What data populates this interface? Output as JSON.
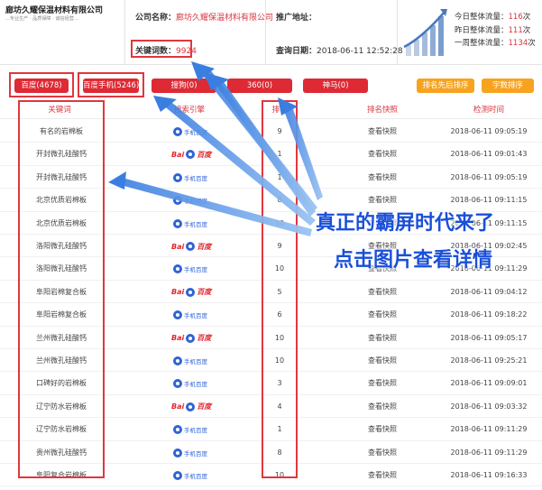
{
  "company": {
    "logo_name": "廊坊久耀保温材料有限公司",
    "logo_tagline": "...专业生产 · 品质保障 · 诚信经营...",
    "name_label": "公司名称：",
    "name_value": "廊坊久耀保温材料有限公司",
    "keywords_label": "关键词数：",
    "keywords_value": "9924",
    "site_label": "推广地址：",
    "site_value": "",
    "query_label": "查询日期：",
    "query_value": "2018-06-11 12:52:28"
  },
  "stats": {
    "today_label": "今日整体流量：",
    "today_value": "116",
    "yesterday_label": "昨日整体流量：",
    "yesterday_value": "111",
    "week_label": "一周整体流量：",
    "week_value": "1134",
    "unit": "次"
  },
  "tabs": [
    {
      "label": "百度(4678)"
    },
    {
      "label": "百度手机(5246)"
    },
    {
      "label": "搜狗(0)"
    },
    {
      "label": "360(0)"
    },
    {
      "label": "神马(0)"
    }
  ],
  "buttons": {
    "sort_rank": "排名先后排序",
    "sort_char": "字数排序"
  },
  "table": {
    "headers": [
      "关键词",
      "搜索引擎",
      "排名",
      "排名快照",
      "检测时间"
    ],
    "rows": [
      {
        "keyword": "有名的岩棉板",
        "engine": "mobile",
        "rank": "9",
        "snapshot": "查看快照",
        "time": "2018-06-11 09:05:19"
      },
      {
        "keyword": "开封微孔硅酸钙",
        "engine": "baidu",
        "rank": "1",
        "snapshot": "查看快照",
        "time": "2018-06-11 09:01:43"
      },
      {
        "keyword": "开封微孔硅酸钙",
        "engine": "mobile",
        "rank": "1",
        "snapshot": "查看快照",
        "time": "2018-06-11 09:05:19"
      },
      {
        "keyword": "北京优质岩棉板",
        "engine": "mobile",
        "rank": "8",
        "snapshot": "查看快照",
        "time": "2018-06-11 09:11:15"
      },
      {
        "keyword": "北京优质岩棉板",
        "engine": "mobile",
        "rank": "10",
        "snapshot": "查看快照",
        "time": "2018-06-11 09:11:15"
      },
      {
        "keyword": "洛阳微孔硅酸钙",
        "engine": "baidu",
        "rank": "9",
        "snapshot": "查看快照",
        "time": "2018-06-11 09:02:45"
      },
      {
        "keyword": "洛阳微孔硅酸钙",
        "engine": "mobile",
        "rank": "10",
        "snapshot": "查看快照",
        "time": "2018-06-11 09:11:29"
      },
      {
        "keyword": "阜阳岩棉复合板",
        "engine": "baidu",
        "rank": "5",
        "snapshot": "查看快照",
        "time": "2018-06-11 09:04:12"
      },
      {
        "keyword": "阜阳岩棉复合板",
        "engine": "mobile",
        "rank": "6",
        "snapshot": "查看快照",
        "time": "2018-06-11 09:18:22"
      },
      {
        "keyword": "兰州微孔硅酸钙",
        "engine": "baidu",
        "rank": "10",
        "snapshot": "查看快照",
        "time": "2018-06-11 09:05:17"
      },
      {
        "keyword": "兰州微孔硅酸钙",
        "engine": "mobile",
        "rank": "10",
        "snapshot": "查看快照",
        "time": "2018-06-11 09:25:21"
      },
      {
        "keyword": "口碑好的岩棉板",
        "engine": "mobile",
        "rank": "3",
        "snapshot": "查看快照",
        "time": "2018-06-11 09:09:01"
      },
      {
        "keyword": "辽宁防水岩棉板",
        "engine": "baidu",
        "rank": "4",
        "snapshot": "查看快照",
        "time": "2018-06-11 09:03:32"
      },
      {
        "keyword": "辽宁防水岩棉板",
        "engine": "mobile",
        "rank": "1",
        "snapshot": "查看快照",
        "time": "2018-06-11 09:11:29"
      },
      {
        "keyword": "贵州微孔硅酸钙",
        "engine": "mobile",
        "rank": "8",
        "snapshot": "查看快照",
        "time": "2018-06-11 09:11:29"
      },
      {
        "keyword": "阜阳复合岩棉板",
        "engine": "mobile",
        "rank": "10",
        "snapshot": "查看快照",
        "time": "2018-06-11 09:16:33"
      }
    ]
  },
  "engine_labels": {
    "baidu_bai": "Bai",
    "baidu_du": "百度",
    "mobile": "手机百度"
  },
  "overlay": {
    "line1": "真正的霸屏时代来了",
    "line2": "点击图片查看详情"
  },
  "colors": {
    "brand_red": "#dd2a35",
    "highlight_box": "#e0373e",
    "orange": "#f7a31f",
    "arrow_blue": "#4a8fe0",
    "overlay_text": "#1a4fd8"
  }
}
